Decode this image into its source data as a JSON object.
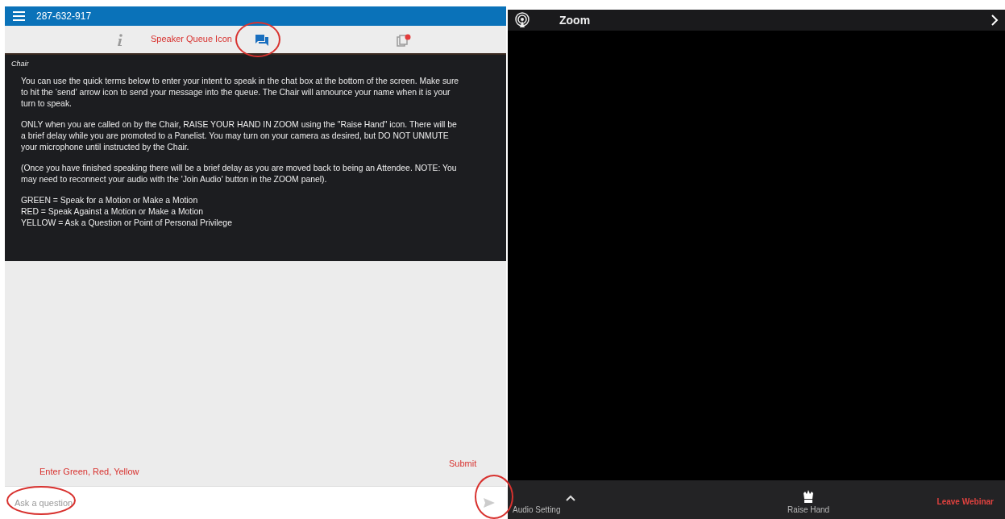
{
  "header": {
    "meeting_id": "287-632-917"
  },
  "tabs": [
    {
      "kind": "info",
      "selected": false
    },
    {
      "kind": "chat",
      "selected": true
    },
    {
      "kind": "documents",
      "selected": false,
      "badge": true
    }
  ],
  "message": {
    "sender": "Chair",
    "paragraphs": [
      "You can use the quick terms below to enter your intent to speak in the chat box at the bottom of the screen. Make sure to hit the ‘send’ arrow icon to send your message into the queue. The Chair will announce your name when it is your turn to speak.",
      "ONLY when you are called on by the Chair, RAISE YOUR HAND IN ZOOM using the \"Raise Hand\" icon. There will be a brief delay while you are promoted to a Panelist. You may turn on your camera as desired, but DO NOT UNMUTE your microphone until instructed by the Chair.",
      "(Once you have finished speaking there will be a brief delay as you are moved back to being an Attendee.  NOTE: You may need to reconnect your audio with the 'Join Audio' button in the ZOOM panel).",
      "GREEN = Speak for a Motion or Make a Motion\nRED = Speak Against a Motion or Make a Motion\nYELLOW = Ask a Question or Point of Personal Privilege"
    ]
  },
  "chat_input": {
    "placeholder": "Ask a question"
  },
  "annotations": {
    "tab_label": "Speaker Queue Icon",
    "input_label": "Enter Green, Red, Yellow",
    "send_label": "Submit"
  },
  "zoom_panel": {
    "title": "Zoom",
    "audio_setting": "Audio Setting",
    "raise_hand": "Raise Hand",
    "leave": "Leave Webinar"
  }
}
